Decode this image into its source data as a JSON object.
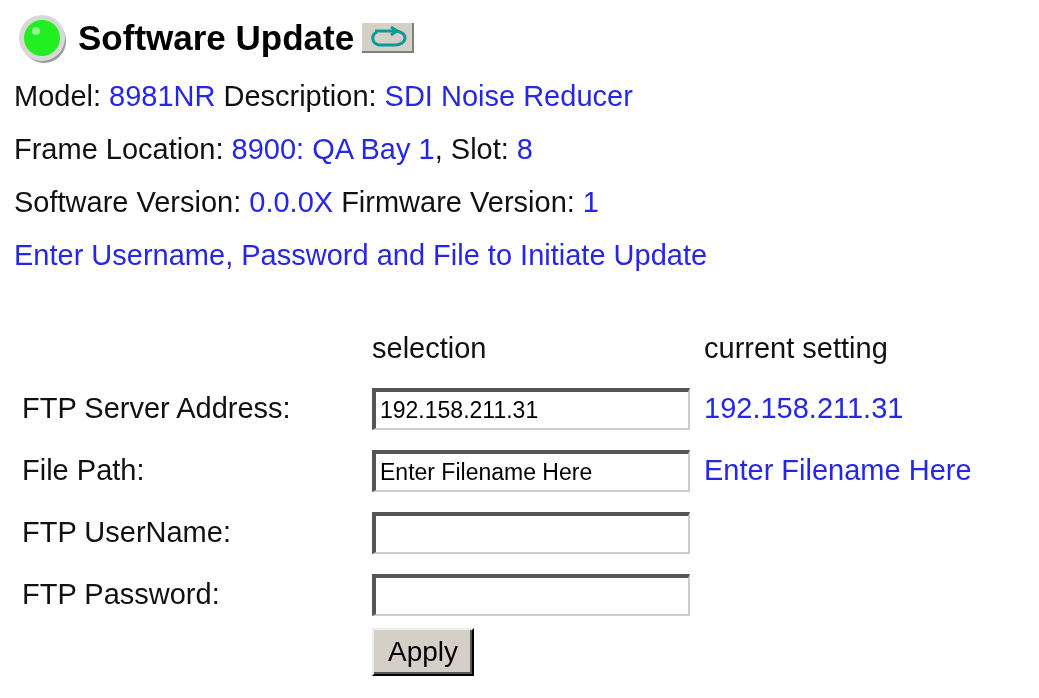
{
  "header": {
    "status_ok": true,
    "title": "Software Update"
  },
  "info_lines": [
    [
      {
        "kind": "label",
        "text": "Model:"
      },
      {
        "kind": "value",
        "text": "8981NR"
      },
      {
        "kind": "label",
        "text": "Description:"
      },
      {
        "kind": "value",
        "text": "SDI Noise Reducer"
      }
    ],
    [
      {
        "kind": "label",
        "text": "Frame Location:"
      },
      {
        "kind": "value",
        "text": "8900: QA Bay 1"
      },
      {
        "kind": "label",
        "text": ", Slot:"
      },
      {
        "kind": "value",
        "text": "8"
      }
    ],
    [
      {
        "kind": "label",
        "text": "Software Version:"
      },
      {
        "kind": "value",
        "text": "0.0.0X"
      },
      {
        "kind": "label",
        "text": "Firmware Version:"
      },
      {
        "kind": "value",
        "text": "1"
      }
    ],
    [
      {
        "kind": "value",
        "text": "Enter Username, Password and File to Initiate Update"
      }
    ]
  ],
  "form": {
    "columns": [
      "selection",
      "current setting"
    ],
    "rows": [
      {
        "label": "FTP Server Address:",
        "value": "192.158.211.31",
        "current": "192.158.211.31"
      },
      {
        "label": "File Path:",
        "value": "Enter Filename Here",
        "current": "Enter Filename Here"
      },
      {
        "label": "FTP UserName:"
      },
      {
        "label": "FTP Password:"
      }
    ],
    "button": "Apply"
  }
}
